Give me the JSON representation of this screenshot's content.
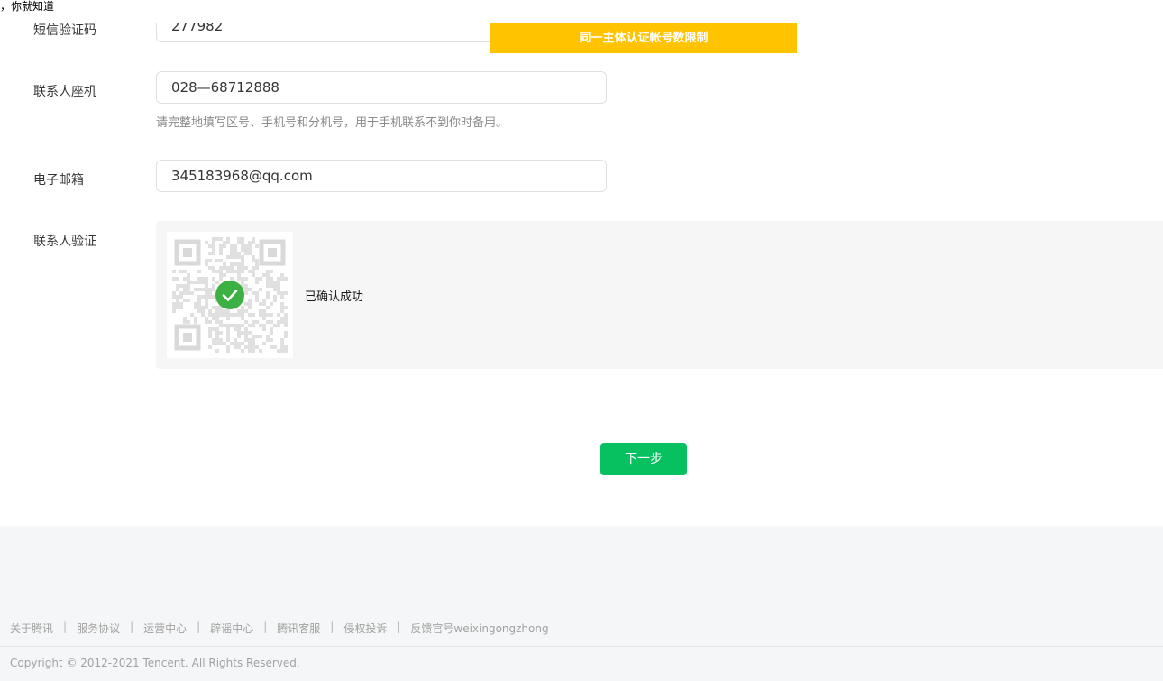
{
  "topbar": {
    "text": "，你就知道"
  },
  "toast": {
    "text": "同一主体认证帐号数限制"
  },
  "form": {
    "sms_code": {
      "label": "短信验证码",
      "value": "277982"
    },
    "landline": {
      "label": "联系人座机",
      "value": "028—68712888",
      "hint": "请完整地填写区号、手机号和分机号，用于手机联系不到你时备用。"
    },
    "email": {
      "label": "电子邮箱",
      "value": "345183968@qq.com"
    },
    "contact_verify": {
      "label": "联系人验证",
      "status": "已确认成功"
    }
  },
  "next_button": {
    "label": "下一步"
  },
  "footer": {
    "links": [
      {
        "label": "关于腾讯"
      },
      {
        "label": "服务协议"
      },
      {
        "label": "运营中心"
      },
      {
        "label": "辟谣中心"
      },
      {
        "label": "腾讯客服"
      },
      {
        "label": "侵权投诉"
      },
      {
        "label": "反馈官号weixingongzhong"
      }
    ],
    "separator": "|",
    "copyright": "Copyright © 2012-2021 Tencent. All Rights Reserved."
  },
  "colors": {
    "toast_bg": "#ffc300",
    "primary_button": "#07c160",
    "success_check": "#3cb043",
    "verify_panel_bg": "#f6f6f7",
    "footer_bg": "#f5f6f7"
  },
  "icons": {
    "qr": "qr-code-icon",
    "check": "check-circle-icon"
  }
}
